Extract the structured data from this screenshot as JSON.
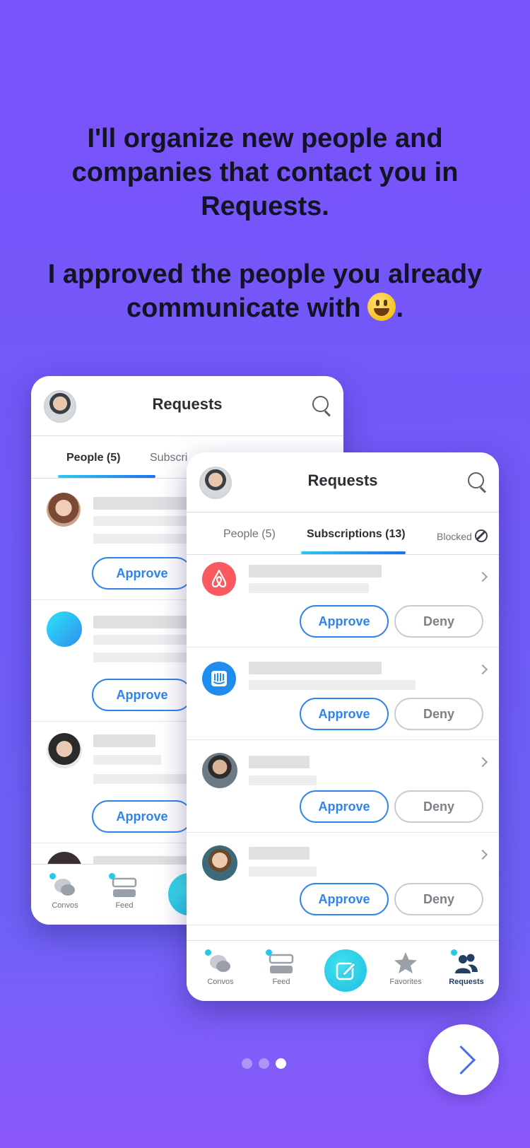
{
  "headline": {
    "line1": "I'll organize new people and companies that contact you in Requests.",
    "line2": "I approved the people you already communicate with",
    "line2_end": "."
  },
  "back_card": {
    "title": "Requests",
    "tabs": [
      "People (5)",
      "Subscri"
    ],
    "approve_label": "Approve",
    "nav": {
      "convos": "Convos",
      "feed": "Feed"
    }
  },
  "front_card": {
    "title": "Requests",
    "tabs": {
      "people": "People (5)",
      "subscriptions": "Subscriptions (13)",
      "blocked": "Blocked"
    },
    "approve_label": "Approve",
    "deny_label": "Deny",
    "nav": {
      "convos": "Convos",
      "feed": "Feed",
      "favorites": "Favorites",
      "requests": "Requests"
    }
  },
  "colors": {
    "accent": "#2f83ee",
    "airbnb": "#fa5a5f",
    "intercom": "#1f8ded",
    "compose": "#26c7ea"
  },
  "pager": {
    "pages": 3,
    "active_page": 3
  }
}
